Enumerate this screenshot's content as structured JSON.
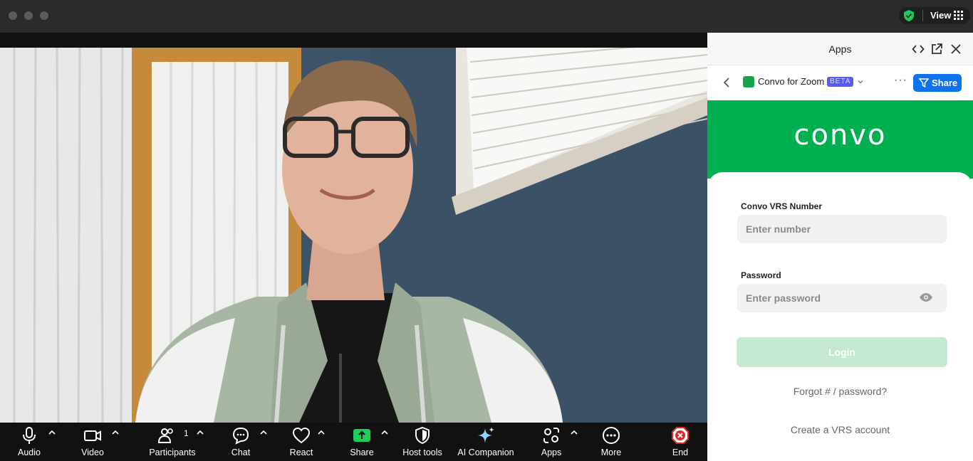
{
  "titlebar": {
    "view_label": "View"
  },
  "toolbar": {
    "items": [
      {
        "label": "Audio",
        "icon": "microphone-icon"
      },
      {
        "label": "Video",
        "icon": "video-camera-icon"
      },
      {
        "label": "Participants",
        "icon": "participants-icon",
        "count": "1"
      },
      {
        "label": "Chat",
        "icon": "chat-icon"
      },
      {
        "label": "React",
        "icon": "heart-icon"
      },
      {
        "label": "Share",
        "icon": "share-screen-icon"
      },
      {
        "label": "Host tools",
        "icon": "shield-icon"
      },
      {
        "label": "AI Companion",
        "icon": "sparkle-icon"
      },
      {
        "label": "Apps",
        "icon": "apps-icon"
      },
      {
        "label": "More",
        "icon": "more-icon"
      },
      {
        "label": "End",
        "icon": "end-icon"
      }
    ]
  },
  "panel": {
    "title": "Apps",
    "app_name": "Convo for Zoom",
    "beta_badge": "BETA",
    "share_label": "Share",
    "brand": "convo",
    "vrs_label": "Convo VRS Number",
    "vrs_placeholder": "Enter number",
    "password_label": "Password",
    "password_placeholder": "Enter password",
    "login_label": "Login",
    "forgot_link": "Forgot # / password?",
    "create_link": "Create a VRS account"
  },
  "colors": {
    "brand_green": "#00b050",
    "share_blue": "#0e72ed",
    "share_screen_green": "#1dce5a",
    "end_red": "#e02828"
  }
}
